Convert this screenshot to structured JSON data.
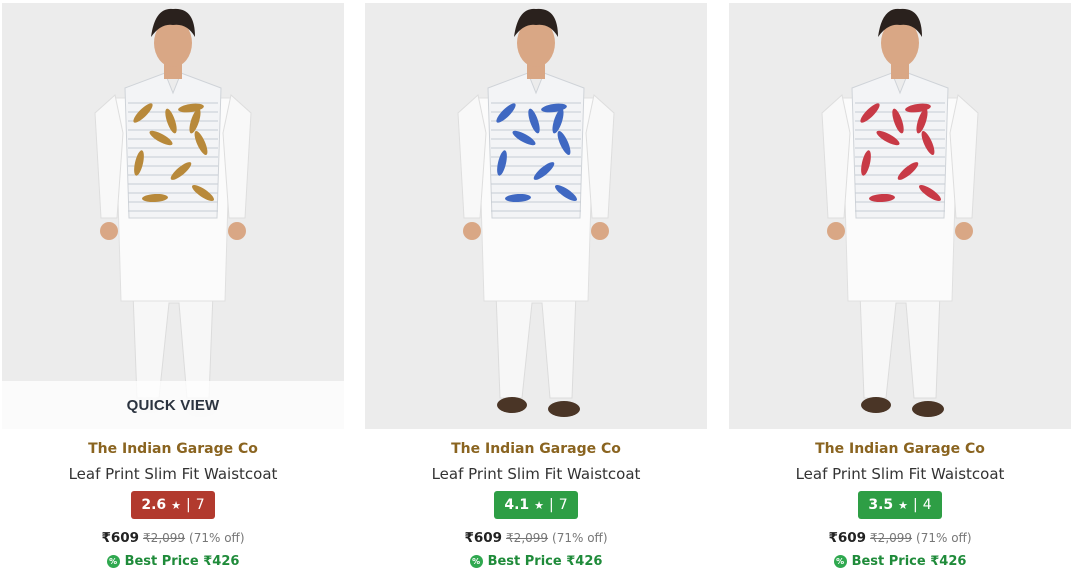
{
  "products": [
    {
      "brand": "The Indian Garage Co",
      "title": "Leaf Print Slim Fit Waistcoat",
      "rating": "2.6",
      "rating_count": "7",
      "rating_color": "#b23a2e",
      "price": "₹609",
      "mrp": "₹2,099",
      "discount": "(71% off)",
      "best_price": "Best Price ₹426",
      "leaf_color": "#b8893a",
      "quick_view": "QUICK VIEW",
      "image_icon": "model-in-waistcoat-image",
      "footwear": "white"
    },
    {
      "brand": "The Indian Garage Co",
      "title": "Leaf Print Slim Fit Waistcoat",
      "rating": "4.1",
      "rating_count": "7",
      "rating_color": "#2e9e45",
      "price": "₹609",
      "mrp": "₹2,099",
      "discount": "(71% off)",
      "best_price": "Best Price ₹426",
      "leaf_color": "#3f68c2",
      "image_icon": "model-in-waistcoat-image",
      "footwear": "brown"
    },
    {
      "brand": "The Indian Garage Co",
      "title": "Leaf Print Slim Fit Waistcoat",
      "rating": "3.5",
      "rating_count": "4",
      "rating_color": "#2e9e45",
      "price": "₹609",
      "mrp": "₹2,099",
      "discount": "(71% off)",
      "best_price": "Best Price ₹426",
      "leaf_color": "#c83a46",
      "image_icon": "model-in-waistcoat-image",
      "footwear": "brown"
    }
  ],
  "icons": {
    "rating_star": "★",
    "rating_separator": "|",
    "best_price_icon": "%"
  }
}
